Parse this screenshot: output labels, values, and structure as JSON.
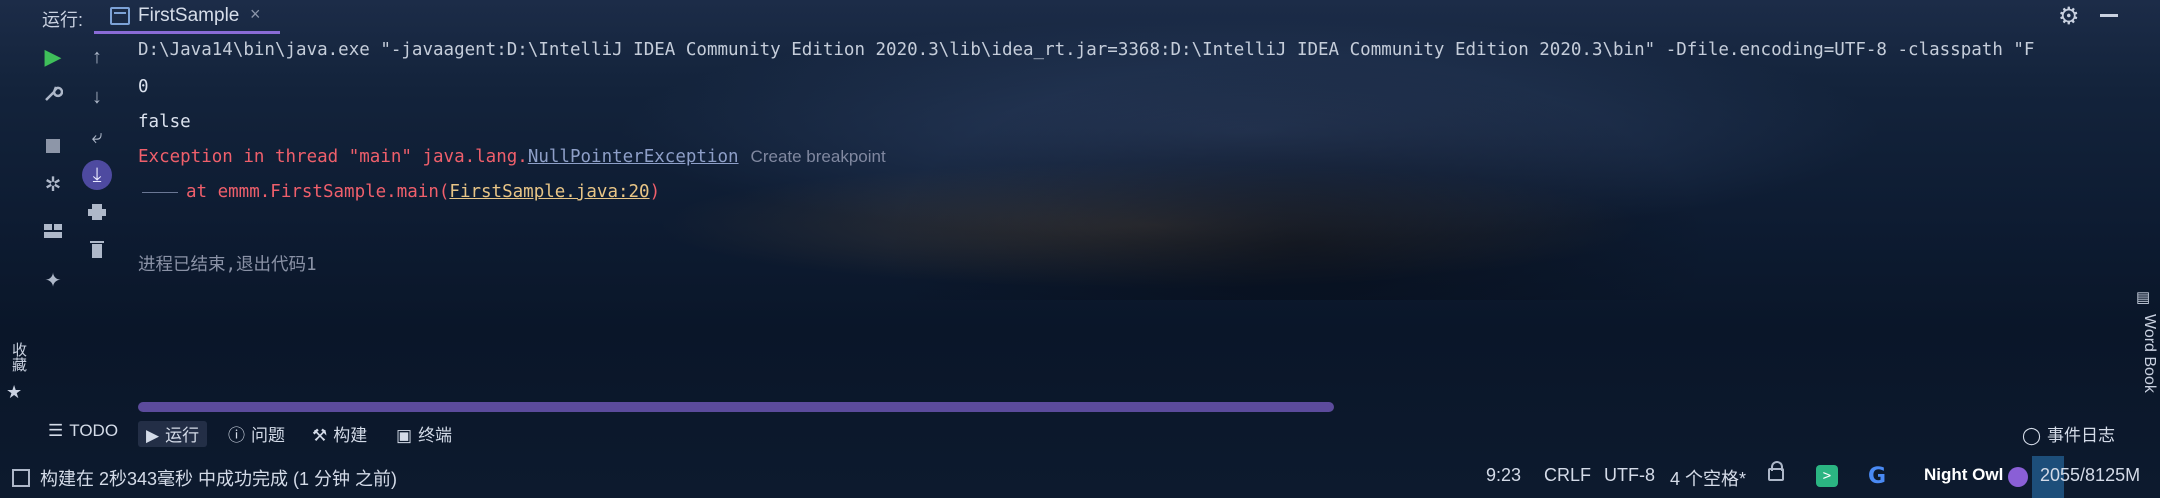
{
  "header": {
    "run_label": "运行:",
    "tab_name": "FirstSample",
    "tab_close": "×",
    "settings_icon": "⚙"
  },
  "console": {
    "cmd": "D:\\Java14\\bin\\java.exe \"-javaagent:D:\\IntelliJ IDEA Community Edition 2020.3\\lib\\idea_rt.jar=3368:D:\\IntelliJ IDEA Community Edition 2020.3\\bin\" -Dfile.encoding=UTF-8 -classpath \"F",
    "out1": "0",
    "out2": "false",
    "exception_prefix": "Exception in thread \"main\" java.lang.",
    "exception_link": "NullPointerException",
    "create_breakpoint": "Create breakpoint",
    "at_prefix": "at emmm.FirstSample.main(",
    "at_file": "FirstSample.java:20",
    "at_suffix": ")",
    "exit_line": "进程已结束,退出代码1"
  },
  "side": {
    "favorites": "收藏",
    "word_book": "Word Book"
  },
  "bottom_tools": {
    "todo": "TODO",
    "run": "运行",
    "problems": "问题",
    "build": "构建",
    "terminal": "终端",
    "event_log": "事件日志"
  },
  "statusbar": {
    "build_message": "构建在 2秒343毫秒 中成功完成 (1 分钟 之前)",
    "position": "9:23",
    "line_sep": "CRLF",
    "encoding": "UTF-8",
    "indent": "4 个空格*",
    "theme": "Night Owl",
    "memory": "2055/8125M"
  },
  "colors": {
    "accent_purple": "#8a6bd6",
    "error_red": "#ef5f6b",
    "run_green": "#3fbf5a",
    "link_yellow": "#e8c586"
  }
}
